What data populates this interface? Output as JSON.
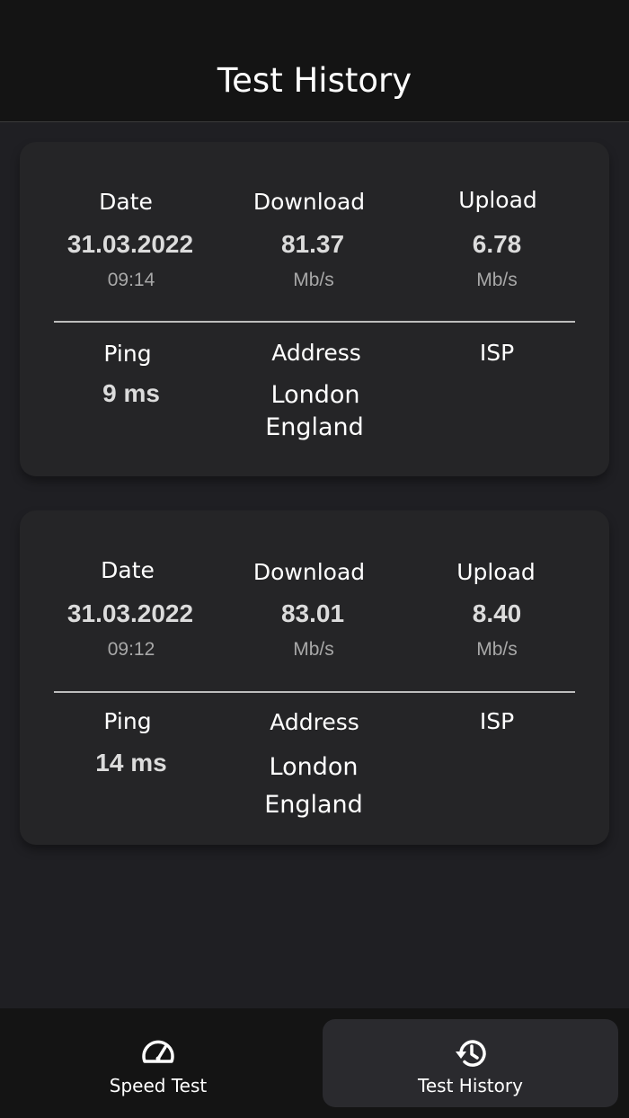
{
  "header": {
    "title": "Test History"
  },
  "labels": {
    "date": "Date",
    "download": "Download",
    "upload": "Upload",
    "ping": "Ping",
    "address": "Address",
    "isp": "ISP"
  },
  "tests": [
    {
      "date": "31.03.2022",
      "time": "09:14",
      "download": "81.37",
      "download_unit": "Mb/s",
      "upload": "6.78",
      "upload_unit": "Mb/s",
      "ping": "9 ms",
      "address_city": "London",
      "address_region": "England",
      "isp": ""
    },
    {
      "date": "31.03.2022",
      "time": "09:12",
      "download": "83.01",
      "download_unit": "Mb/s",
      "upload": "8.40",
      "upload_unit": "Mb/s",
      "ping": "14 ms",
      "address_city": "London",
      "address_region": "England",
      "isp": ""
    }
  ],
  "nav": {
    "items": [
      {
        "label": "Speed Test",
        "icon": "speedometer-icon"
      },
      {
        "label": "Test History",
        "icon": "history-icon",
        "active": true
      }
    ]
  }
}
